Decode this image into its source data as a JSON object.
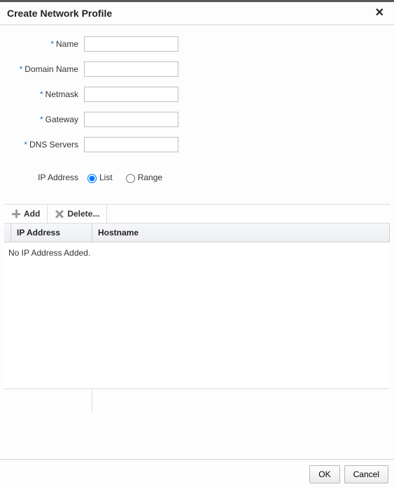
{
  "title": "Create Network Profile",
  "form": {
    "name": {
      "label": "Name",
      "value": ""
    },
    "domain": {
      "label": "Domain Name",
      "value": ""
    },
    "netmask": {
      "label": "Netmask",
      "value": ""
    },
    "gateway": {
      "label": "Gateway",
      "value": ""
    },
    "dns": {
      "label": "DNS Servers",
      "value": ""
    },
    "ip_address_label": "IP Address",
    "ip_mode": {
      "list": "List",
      "range": "Range",
      "selected": "list"
    }
  },
  "toolbar": {
    "add": "Add",
    "delete": "Delete..."
  },
  "grid": {
    "col_ip": "IP Address",
    "col_host": "Hostname",
    "empty": "No IP Address Added."
  },
  "buttons": {
    "ok": "OK",
    "cancel": "Cancel"
  }
}
